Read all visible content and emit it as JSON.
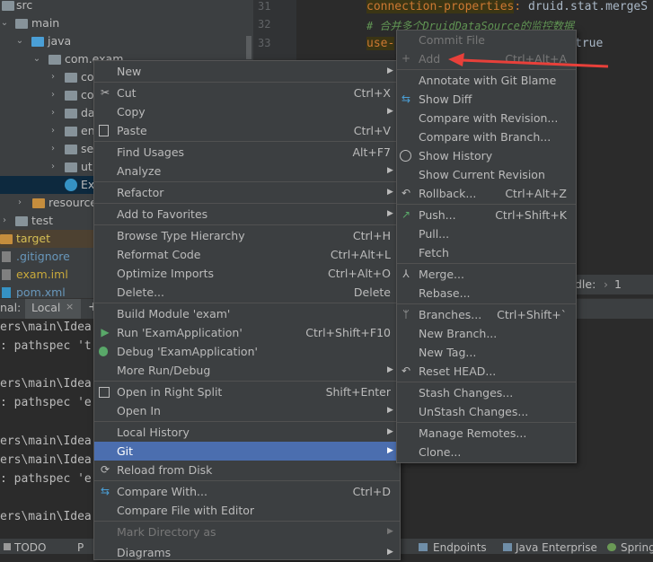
{
  "tree": {
    "items": [
      {
        "label": "src"
      },
      {
        "label": "main"
      },
      {
        "label": "java"
      },
      {
        "label": "com.exam"
      },
      {
        "label": "co"
      },
      {
        "label": "co"
      },
      {
        "label": "da"
      },
      {
        "label": "en"
      },
      {
        "label": "ser"
      },
      {
        "label": "uti"
      },
      {
        "label": "Exa"
      },
      {
        "label": "resource"
      },
      {
        "label": "test"
      },
      {
        "label": "target"
      },
      {
        "label": ".gitignore"
      },
      {
        "label": "exam.iml"
      },
      {
        "label": "pom.xml"
      }
    ]
  },
  "editor": {
    "line_numbers": [
      "31",
      "32",
      "33"
    ],
    "line1_key": "connection-properties",
    "line1_sep": ": ",
    "line1_val": "druid.stat.mergeS",
    "line2": "# 合并多个DruidDataSource的监控数据",
    "line3_key": "use-",
    "line3_val": "true"
  },
  "terminal": {
    "tab_prefix": "nal:",
    "tab_label": "Local",
    "tab_plus": "+",
    "tab_chevron": "∨",
    "lines": [
      "ers\\main\\Idea",
      ": pathspec 't",
      "ers\\main\\Idea",
      ": pathspec 'e",
      "ers\\main\\Idea",
      "ers\\main\\Idea",
      ": pathspec 'e",
      "ers\\main\\Idea"
    ]
  },
  "right_snip": {
    "label": "dle:",
    "value": "1"
  },
  "statusbar": {
    "todo": "TODO",
    "problems": "P",
    "endpoints": "Endpoints",
    "enterprise": "Java Enterprise",
    "spring": "Spring"
  },
  "context_menu": {
    "items": [
      {
        "label": "New",
        "shortcut": "",
        "submenu": true
      },
      {
        "label": "Cut",
        "shortcut": "Ctrl+X",
        "icon": "✂"
      },
      {
        "label": "Copy",
        "shortcut": "",
        "submenu": true
      },
      {
        "label": "Paste",
        "shortcut": "Ctrl+V",
        "icon": "📋"
      },
      {
        "label": "Find Usages",
        "shortcut": "Alt+F7"
      },
      {
        "label": "Analyze",
        "shortcut": "",
        "submenu": true
      },
      {
        "label": "Refactor",
        "shortcut": "",
        "submenu": true
      },
      {
        "label": "Add to Favorites",
        "shortcut": "",
        "submenu": true
      },
      {
        "label": "Browse Type Hierarchy",
        "shortcut": "Ctrl+H"
      },
      {
        "label": "Reformat Code",
        "shortcut": "Ctrl+Alt+L"
      },
      {
        "label": "Optimize Imports",
        "shortcut": "Ctrl+Alt+O"
      },
      {
        "label": "Delete...",
        "shortcut": "Delete"
      },
      {
        "label": "Build Module 'exam'",
        "shortcut": ""
      },
      {
        "label": "Run 'ExamApplication'",
        "shortcut": "Ctrl+Shift+F10",
        "icon": "▶"
      },
      {
        "label": "Debug 'ExamApplication'",
        "shortcut": "",
        "icon": "🐞"
      },
      {
        "label": "More Run/Debug",
        "shortcut": "",
        "submenu": true
      },
      {
        "label": "Open in Right Split",
        "shortcut": "Shift+Enter",
        "icon": "◫"
      },
      {
        "label": "Open In",
        "shortcut": "",
        "submenu": true
      },
      {
        "label": "Local History",
        "shortcut": "",
        "submenu": true
      },
      {
        "label": "Git",
        "shortcut": "",
        "submenu": true
      },
      {
        "label": "Reload from Disk",
        "shortcut": "",
        "icon": "⟳"
      },
      {
        "label": "Compare With...",
        "shortcut": "Ctrl+D",
        "icon": "⇆"
      },
      {
        "label": "Compare File with Editor",
        "shortcut": ""
      },
      {
        "label": "Mark Directory as",
        "shortcut": "",
        "submenu": true
      },
      {
        "label": "Diagrams",
        "shortcut": "",
        "submenu": true
      }
    ]
  },
  "git_menu": {
    "items": [
      {
        "label": "Commit File",
        "shortcut": ""
      },
      {
        "label": "Add",
        "shortcut": "Ctrl+Alt+A",
        "icon": "+"
      },
      {
        "label": "Annotate with Git Blame",
        "shortcut": ""
      },
      {
        "label": "Show Diff",
        "shortcut": "",
        "icon": "⇆"
      },
      {
        "label": "Compare with Revision...",
        "shortcut": ""
      },
      {
        "label": "Compare with Branch...",
        "shortcut": ""
      },
      {
        "label": "Show History",
        "shortcut": "",
        "icon": "🕓"
      },
      {
        "label": "Show Current Revision",
        "shortcut": ""
      },
      {
        "label": "Rollback...",
        "shortcut": "Ctrl+Alt+Z",
        "icon": "↶"
      },
      {
        "label": "Push...",
        "shortcut": "Ctrl+Shift+K",
        "icon": "↗"
      },
      {
        "label": "Pull...",
        "shortcut": ""
      },
      {
        "label": "Fetch",
        "shortcut": ""
      },
      {
        "label": "Merge...",
        "shortcut": "",
        "icon": "⅄"
      },
      {
        "label": "Rebase...",
        "shortcut": ""
      },
      {
        "label": "Branches...",
        "shortcut": "Ctrl+Shift+`",
        "icon": "ᛘ"
      },
      {
        "label": "New Branch...",
        "shortcut": ""
      },
      {
        "label": "New Tag...",
        "shortcut": ""
      },
      {
        "label": "Reset HEAD...",
        "shortcut": "",
        "icon": "↶"
      },
      {
        "label": "Stash Changes...",
        "shortcut": ""
      },
      {
        "label": "UnStash Changes...",
        "shortcut": ""
      },
      {
        "label": "Manage Remotes...",
        "shortcut": ""
      },
      {
        "label": "Clone...",
        "shortcut": ""
      }
    ]
  },
  "colors": {
    "selection": "#4b6eaf",
    "annotation_arrow": "#e8403a",
    "key": "#cc7832",
    "comment": "#629755"
  }
}
